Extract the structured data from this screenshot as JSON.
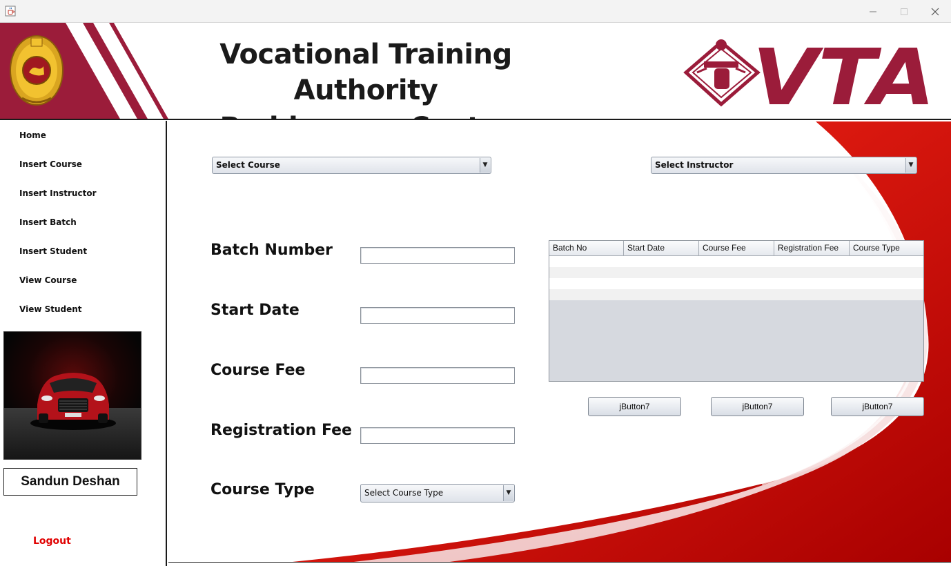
{
  "window": {
    "app_icon": "java-cup-icon",
    "controls": [
      "minimize-icon",
      "maximize-icon",
      "close-icon"
    ]
  },
  "header": {
    "title_line1": "Vocational Training Authority",
    "title_line2": "Baddegama Center",
    "logo_text": "VTA",
    "brand_color": "#9b1c3a"
  },
  "sidebar": {
    "items": [
      {
        "label": "Home"
      },
      {
        "label": "Insert Course"
      },
      {
        "label": "Insert Instructor"
      },
      {
        "label": "Insert Batch"
      },
      {
        "label": "Insert Student"
      },
      {
        "label": "View Course"
      },
      {
        "label": "View Student"
      }
    ],
    "user_name": "Sandun Deshan",
    "logout_label": "Logout",
    "logout_color": "#e00000"
  },
  "main": {
    "course_select": "Select Course",
    "instructor_select": "Select Instructor",
    "form": {
      "batch_number_label": "Batch Number",
      "start_date_label": "Start Date",
      "course_fee_label": "Course Fee",
      "registration_fee_label": "Registration Fee",
      "course_type_label": "Course Type",
      "course_type_select": "Select Course Type",
      "batch_number_value": "",
      "start_date_value": "",
      "course_fee_value": "",
      "registration_fee_value": ""
    },
    "table": {
      "columns": [
        "Batch No",
        "Start Date",
        "Course Fee",
        "Registration Fee",
        "Course Type"
      ],
      "rows": []
    },
    "buttons": [
      "jButton7",
      "jButton7",
      "jButton7"
    ],
    "accent_color": "#d90000"
  }
}
